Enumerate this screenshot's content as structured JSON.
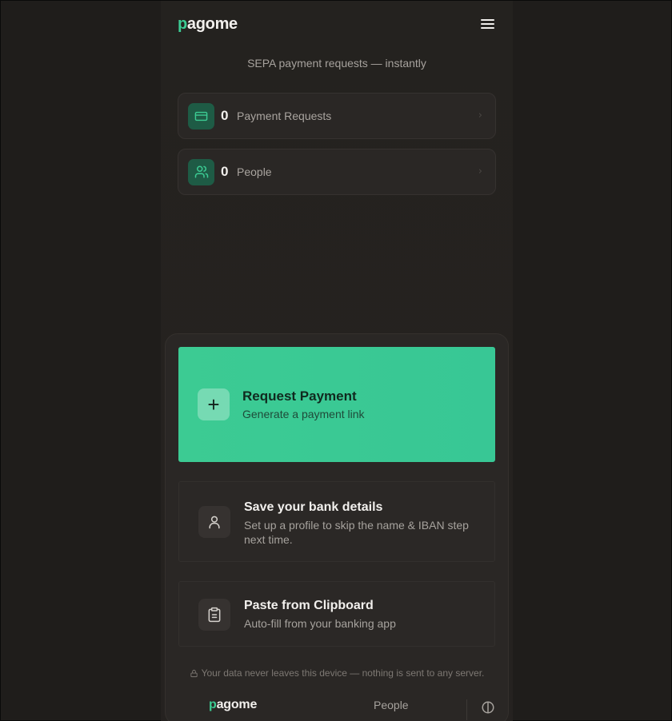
{
  "header": {
    "logo_first": "p",
    "logo_rest": "agome"
  },
  "tagline": "SEPA payment requests — instantly",
  "stats": [
    {
      "count": "0",
      "label": "Payment Requests",
      "icon": "credit-card-icon"
    },
    {
      "count": "0",
      "label": "People",
      "icon": "people-icon"
    }
  ],
  "request": {
    "title": "Request Payment",
    "subtitle": "Generate a payment link",
    "icon": "plus-icon"
  },
  "actions": [
    {
      "title": "Save your bank details",
      "subtitle": "Set up a profile to skip the name & IBAN step next time.",
      "icon": "user-icon"
    },
    {
      "title": "Paste from Clipboard",
      "subtitle": "Auto-fill from your banking app",
      "icon": "clipboard-icon"
    }
  ],
  "privacy_note": "Your data never leaves this device — nothing is sent to any server.",
  "footer": {
    "logo_first": "p",
    "logo_rest": "agome",
    "people_link": "People"
  },
  "colors": {
    "accent": "#3ccb93",
    "background": "#1f1d1b",
    "card": "#2a2725"
  }
}
